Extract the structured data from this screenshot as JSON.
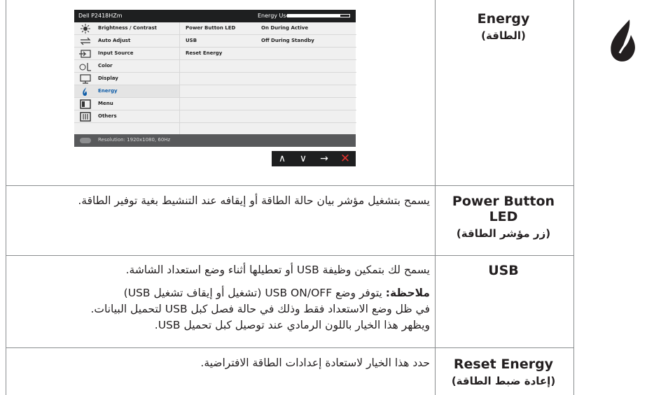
{
  "icon": {
    "name": "energy-leaf-icon",
    "color": "#231f20"
  },
  "osd": {
    "model": "Dell P2418HZm",
    "energy_use_label": "Energy Use",
    "energy_use_level": 0.85,
    "menu_items": [
      {
        "label": "Brightness / Contrast",
        "icon": "brightness-icon"
      },
      {
        "label": "Auto Adjust",
        "icon": "auto-adjust-icon"
      },
      {
        "label": "Input Source",
        "icon": "input-source-icon"
      },
      {
        "label": "Color",
        "icon": "color-icon"
      },
      {
        "label": "Display",
        "icon": "display-icon"
      },
      {
        "label": "Energy",
        "icon": "energy-icon"
      },
      {
        "label": "Menu",
        "icon": "menu-icon"
      },
      {
        "label": "Others",
        "icon": "others-icon"
      }
    ],
    "active_item": "Energy",
    "settings": [
      {
        "key": "Power Button LED",
        "value": "On During Active"
      },
      {
        "key": "USB",
        "value": "Off During Standby"
      },
      {
        "key": "Reset Energy",
        "value": ""
      }
    ],
    "resolution": "Resolution: 1920x1080, 60Hz",
    "buttons": [
      {
        "glyph": "∧",
        "name": "up"
      },
      {
        "glyph": "∨",
        "name": "down"
      },
      {
        "glyph": "→",
        "name": "enter"
      },
      {
        "glyph": "✕",
        "name": "exit"
      }
    ]
  },
  "rows": {
    "energy": {
      "label_en": "Energy",
      "label_ar": "(الطاقة)"
    },
    "power_led": {
      "label_en_1": "Power Button",
      "label_en_2": "LED",
      "label_ar": "(زر مؤشر الطاقة)",
      "desc": "يسمح بتشغيل مؤشر بيان حالة الطاقة أو إيقافه عند التنشيط بغية توفير الطاقة."
    },
    "usb": {
      "label_en": "USB",
      "desc_1": "يسمح لك بتمكين وظيفة USB أو تعطيلها أثناء وضع استعداد الشاشة.",
      "note_label": "ملاحظة:",
      "note_line_1": "يتوفر وضع USB ON/OFF (تشغيل أو إيقاف تشغيل USB)",
      "note_line_2": "في ظل وضع الاستعداد فقط وذلك في حالة فصل كبل USB لتحميل البيانات.",
      "note_line_3": "ويظهر هذا الخيار باللون الرمادي عند توصيل كبل تحميل USB."
    },
    "reset": {
      "label_en": "Reset Energy",
      "label_ar": "(إعادة ضبط الطاقة)",
      "desc": "حدد هذا الخيار لاستعادة إعدادات الطاقة الافتراضية."
    }
  }
}
